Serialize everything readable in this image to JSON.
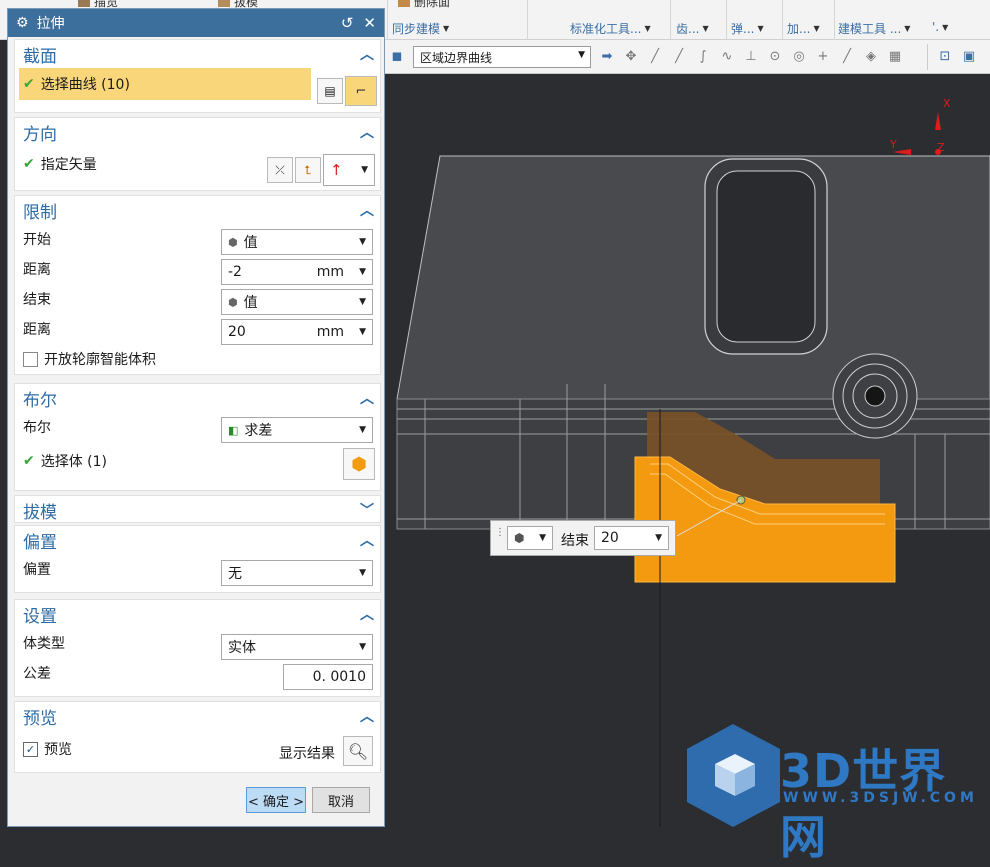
{
  "ribbon": {
    "top_tabs": [
      "描览",
      "拔模",
      "删除面"
    ],
    "groups": [
      "同步建模",
      "标准化工具...",
      "齿...",
      "弹...",
      "加...",
      "建模工具 ...",
      "'."
    ]
  },
  "graphics_toolbar": {
    "selection_filter": "区域边界曲线"
  },
  "dialog": {
    "title": "拉伸",
    "section_head": {
      "title": "截面",
      "select_curve_label": "选择曲线 (10)"
    },
    "direction": {
      "title": "方向",
      "specify_vector_label": "指定矢量"
    },
    "limits": {
      "title": "限制",
      "start_label": "开始",
      "start_value": "值",
      "distance1_label": "距离",
      "distance1_value": "-2",
      "distance1_unit": "mm",
      "end_label": "结束",
      "end_value": "值",
      "distance2_label": "距离",
      "distance2_value": "20",
      "distance2_unit": "mm",
      "open_profile_label": "开放轮廓智能体积"
    },
    "boolean": {
      "title": "布尔",
      "boolean_label": "布尔",
      "boolean_value": "求差",
      "select_body_label": "选择体 (1)"
    },
    "draft": {
      "title": "拔模"
    },
    "offset": {
      "title": "偏置",
      "offset_label": "偏置",
      "offset_value": "无"
    },
    "settings": {
      "title": "设置",
      "body_type_label": "体类型",
      "body_type_value": "实体",
      "tolerance_label": "公差",
      "tolerance_value": "0. 0010"
    },
    "preview": {
      "title": "预览",
      "preview_label": "预览",
      "preview_checked": true,
      "show_result_label": "显示结果"
    },
    "ok_label": "< 确定 >",
    "cancel_label": "取消"
  },
  "floating_toolbar": {
    "label": "结束",
    "value": "20"
  },
  "triad": {
    "x": "X",
    "y": "Y",
    "z": "Z"
  },
  "watermark": {
    "text": "3D世界网",
    "url": "WWW.3DSJW.COM"
  },
  "colors": {
    "accent": "#2e6ca5",
    "title_bar": "#3d6f9d",
    "highlight_row": "#f9d67a",
    "extrude_orange": "#f39a10",
    "watermark_blue": "#2f78c4"
  }
}
